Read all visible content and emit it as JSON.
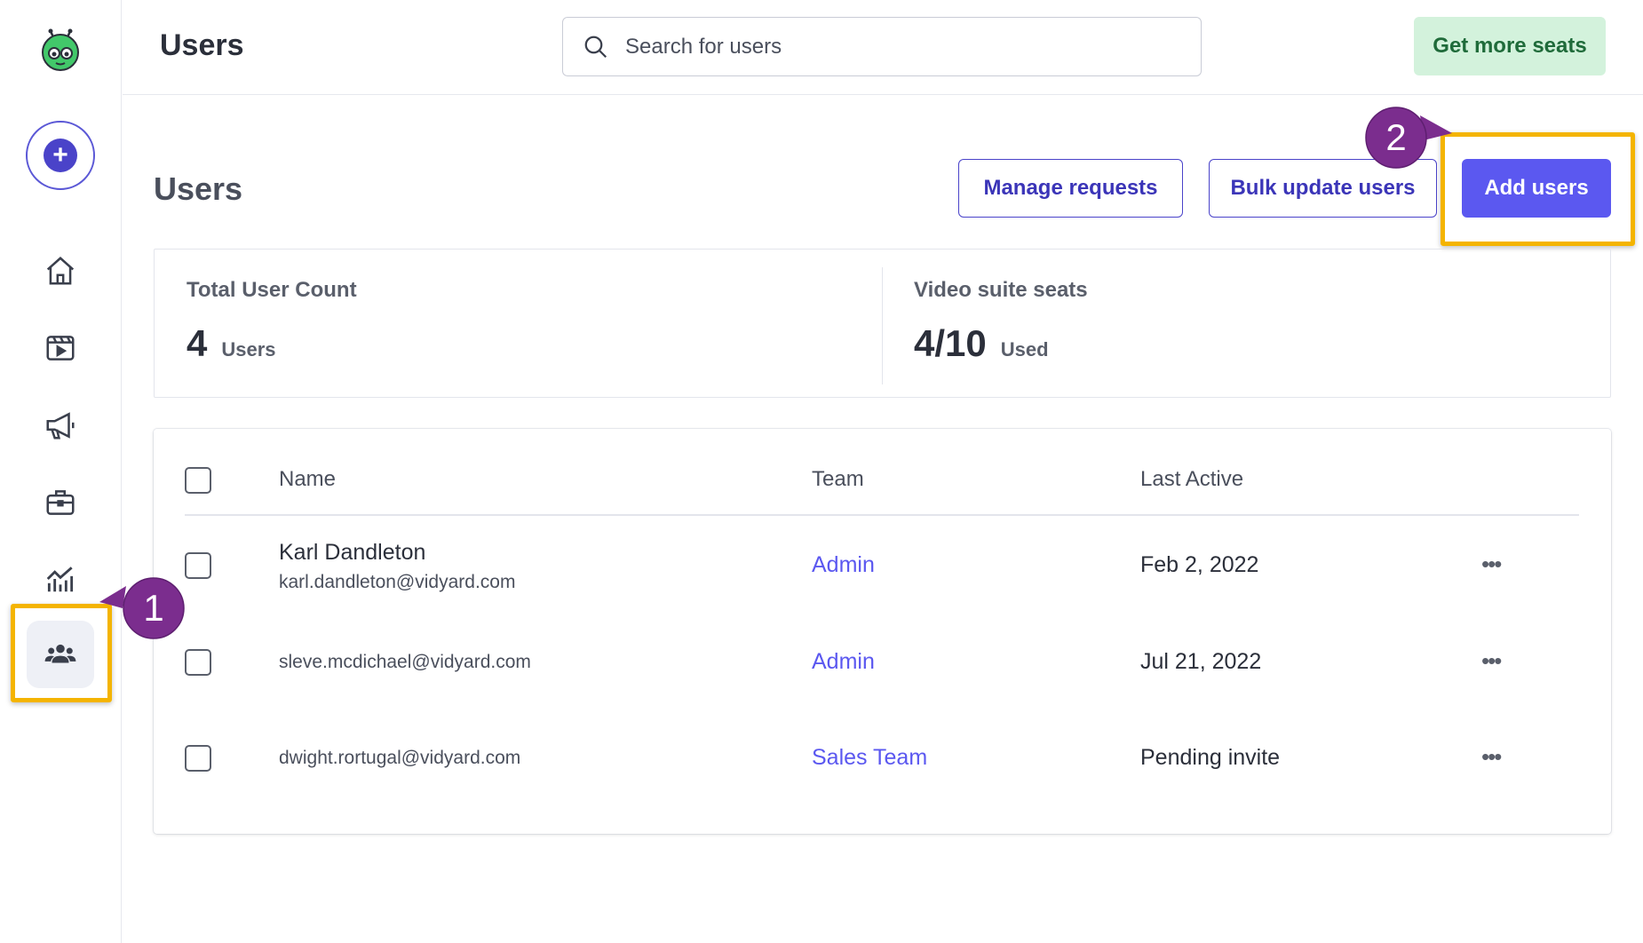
{
  "header": {
    "title": "Users",
    "search_placeholder": "Search for users",
    "get_seats_label": "Get more seats"
  },
  "sidebar": {
    "items": [
      {
        "icon": "home-icon"
      },
      {
        "icon": "video-library-icon"
      },
      {
        "icon": "megaphone-icon"
      },
      {
        "icon": "briefcase-icon"
      },
      {
        "icon": "analytics-icon"
      },
      {
        "icon": "users-icon",
        "active": true
      }
    ]
  },
  "page": {
    "title": "Users",
    "manage_requests_label": "Manage requests",
    "bulk_update_label": "Bulk update users",
    "add_users_label": "Add users"
  },
  "stats": {
    "total": {
      "label": "Total User Count",
      "value": "4",
      "unit": "Users"
    },
    "seats": {
      "label": "Video suite seats",
      "value": "4/10",
      "unit": "Used"
    }
  },
  "table": {
    "headers": {
      "name": "Name",
      "team": "Team",
      "last_active": "Last Active"
    },
    "rows": [
      {
        "name": "Karl Dandleton",
        "email": "karl.dandleton@vidyard.com",
        "team": "Admin",
        "last_active": "Feb 2, 2022",
        "more": "•••"
      },
      {
        "name": "",
        "email": "sleve.mcdichael@vidyard.com",
        "team": "Admin",
        "last_active": "Jul 21, 2022",
        "more": "•••"
      },
      {
        "name": "",
        "email": "dwight.rortugal@vidyard.com",
        "team": "Sales Team",
        "last_active": "Pending invite",
        "more": "•••"
      }
    ]
  },
  "callouts": {
    "step1": "1",
    "step2": "2"
  },
  "colors": {
    "accent": "#5b58f0",
    "highlight": "#f4b400",
    "callout": "#7b2d8e",
    "seats_bg": "#d3f2dc"
  }
}
